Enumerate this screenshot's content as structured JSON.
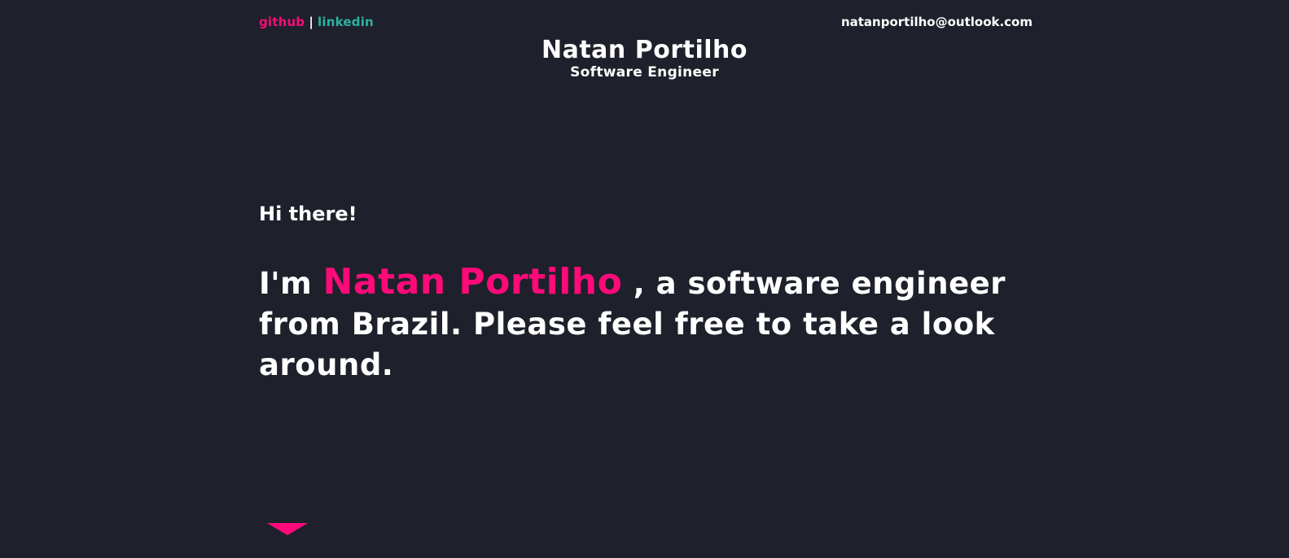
{
  "header": {
    "links": {
      "github": "github",
      "separator": "|",
      "linkedin": "linkedin"
    },
    "email": "natanportilho@outlook.com",
    "name": "Natan Portilho",
    "role": "Software Engineer"
  },
  "hero": {
    "greeting": "Hi there!",
    "intro_prefix": "I'm",
    "intro_name": "Natan Portilho",
    "intro_suffix": ", a software engineer from Brazil. Please feel free to take a look around."
  },
  "icons": {
    "scroll": "triangle-down-icon"
  },
  "colors": {
    "background": "#1e212b",
    "accent_pink": "#ff0a78",
    "accent_teal": "#2bb3a0",
    "text": "#ffffff"
  }
}
